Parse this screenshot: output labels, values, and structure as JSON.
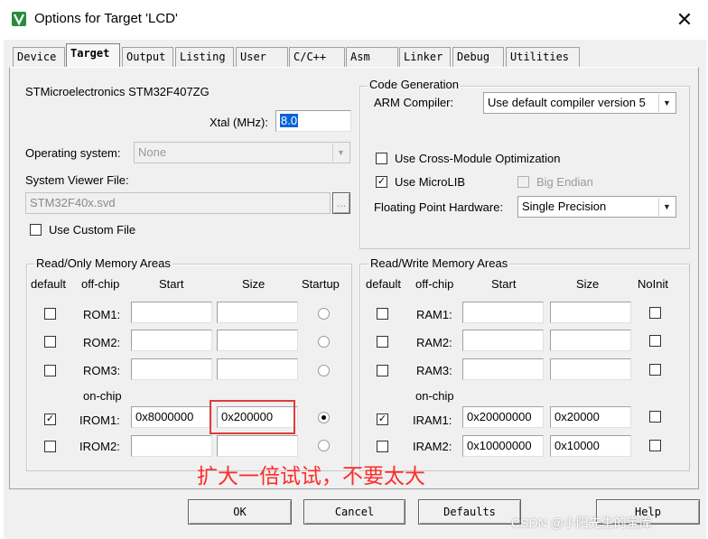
{
  "window": {
    "title": "Options for Target 'LCD'",
    "close_glyph": "✕",
    "icon": "keil-uvision-icon",
    "accent": "#1a8b3a"
  },
  "tabs": [
    {
      "label": "Device"
    },
    {
      "label": "Target"
    },
    {
      "label": "Output"
    },
    {
      "label": "Listing"
    },
    {
      "label": "User"
    },
    {
      "label": "C/C++"
    },
    {
      "label": "Asm"
    },
    {
      "label": "Linker"
    },
    {
      "label": "Debug"
    },
    {
      "label": "Utilities"
    }
  ],
  "active_tab": "Target",
  "device": {
    "name": "STMicroelectronics STM32F407ZG",
    "xtal_label": "Xtal (MHz):",
    "xtal_value": "8.0",
    "os_label": "Operating system:",
    "os_value": "None",
    "svd_label": "System Viewer File:",
    "svd_value": "STM32F40x.svd",
    "browse": "...",
    "custom_file_label": "Use Custom File"
  },
  "codegen": {
    "title": "Code Generation",
    "compiler_label": "ARM Compiler:",
    "compiler_value": "Use default compiler version 5",
    "cross_module_label": "Use Cross-Module Optimization",
    "microlib_label": "Use MicroLIB",
    "big_endian_label": "Big Endian",
    "fpu_label": "Floating Point Hardware:",
    "fpu_value": "Single Precision"
  },
  "rom": {
    "title": "Read/Only Memory Areas",
    "headers": {
      "default": "default",
      "offchip": "off-chip",
      "start": "Start",
      "size": "Size",
      "startup": "Startup"
    },
    "onchip_label": "on-chip",
    "rows": [
      {
        "name": "ROM1:",
        "start": "",
        "size": ""
      },
      {
        "name": "ROM2:",
        "start": "",
        "size": ""
      },
      {
        "name": "ROM3:",
        "start": "",
        "size": ""
      },
      {
        "name": "IROM1:",
        "start": "0x8000000",
        "size": "0x200000"
      },
      {
        "name": "IROM2:",
        "start": "",
        "size": ""
      }
    ]
  },
  "ram": {
    "title": "Read/Write Memory Areas",
    "headers": {
      "default": "default",
      "offchip": "off-chip",
      "start": "Start",
      "size": "Size",
      "noinit": "NoInit"
    },
    "onchip_label": "on-chip",
    "rows": [
      {
        "name": "RAM1:",
        "start": "",
        "size": ""
      },
      {
        "name": "RAM2:",
        "start": "",
        "size": ""
      },
      {
        "name": "RAM3:",
        "start": "",
        "size": ""
      },
      {
        "name": "IRAM1:",
        "start": "0x20000000",
        "size": "0x20000"
      },
      {
        "name": "IRAM2:",
        "start": "0x10000000",
        "size": "0x10000"
      }
    ]
  },
  "buttons": {
    "ok": "OK",
    "cancel": "Cancel",
    "defaults": "Defaults",
    "help": "Help"
  },
  "annotation": "扩大一倍试试，不要太大",
  "watermark": "CSDN @小阳先生的宝库",
  "colors": {
    "annotation": "#ff2b2b",
    "highlight_border": "#e03b3b"
  }
}
